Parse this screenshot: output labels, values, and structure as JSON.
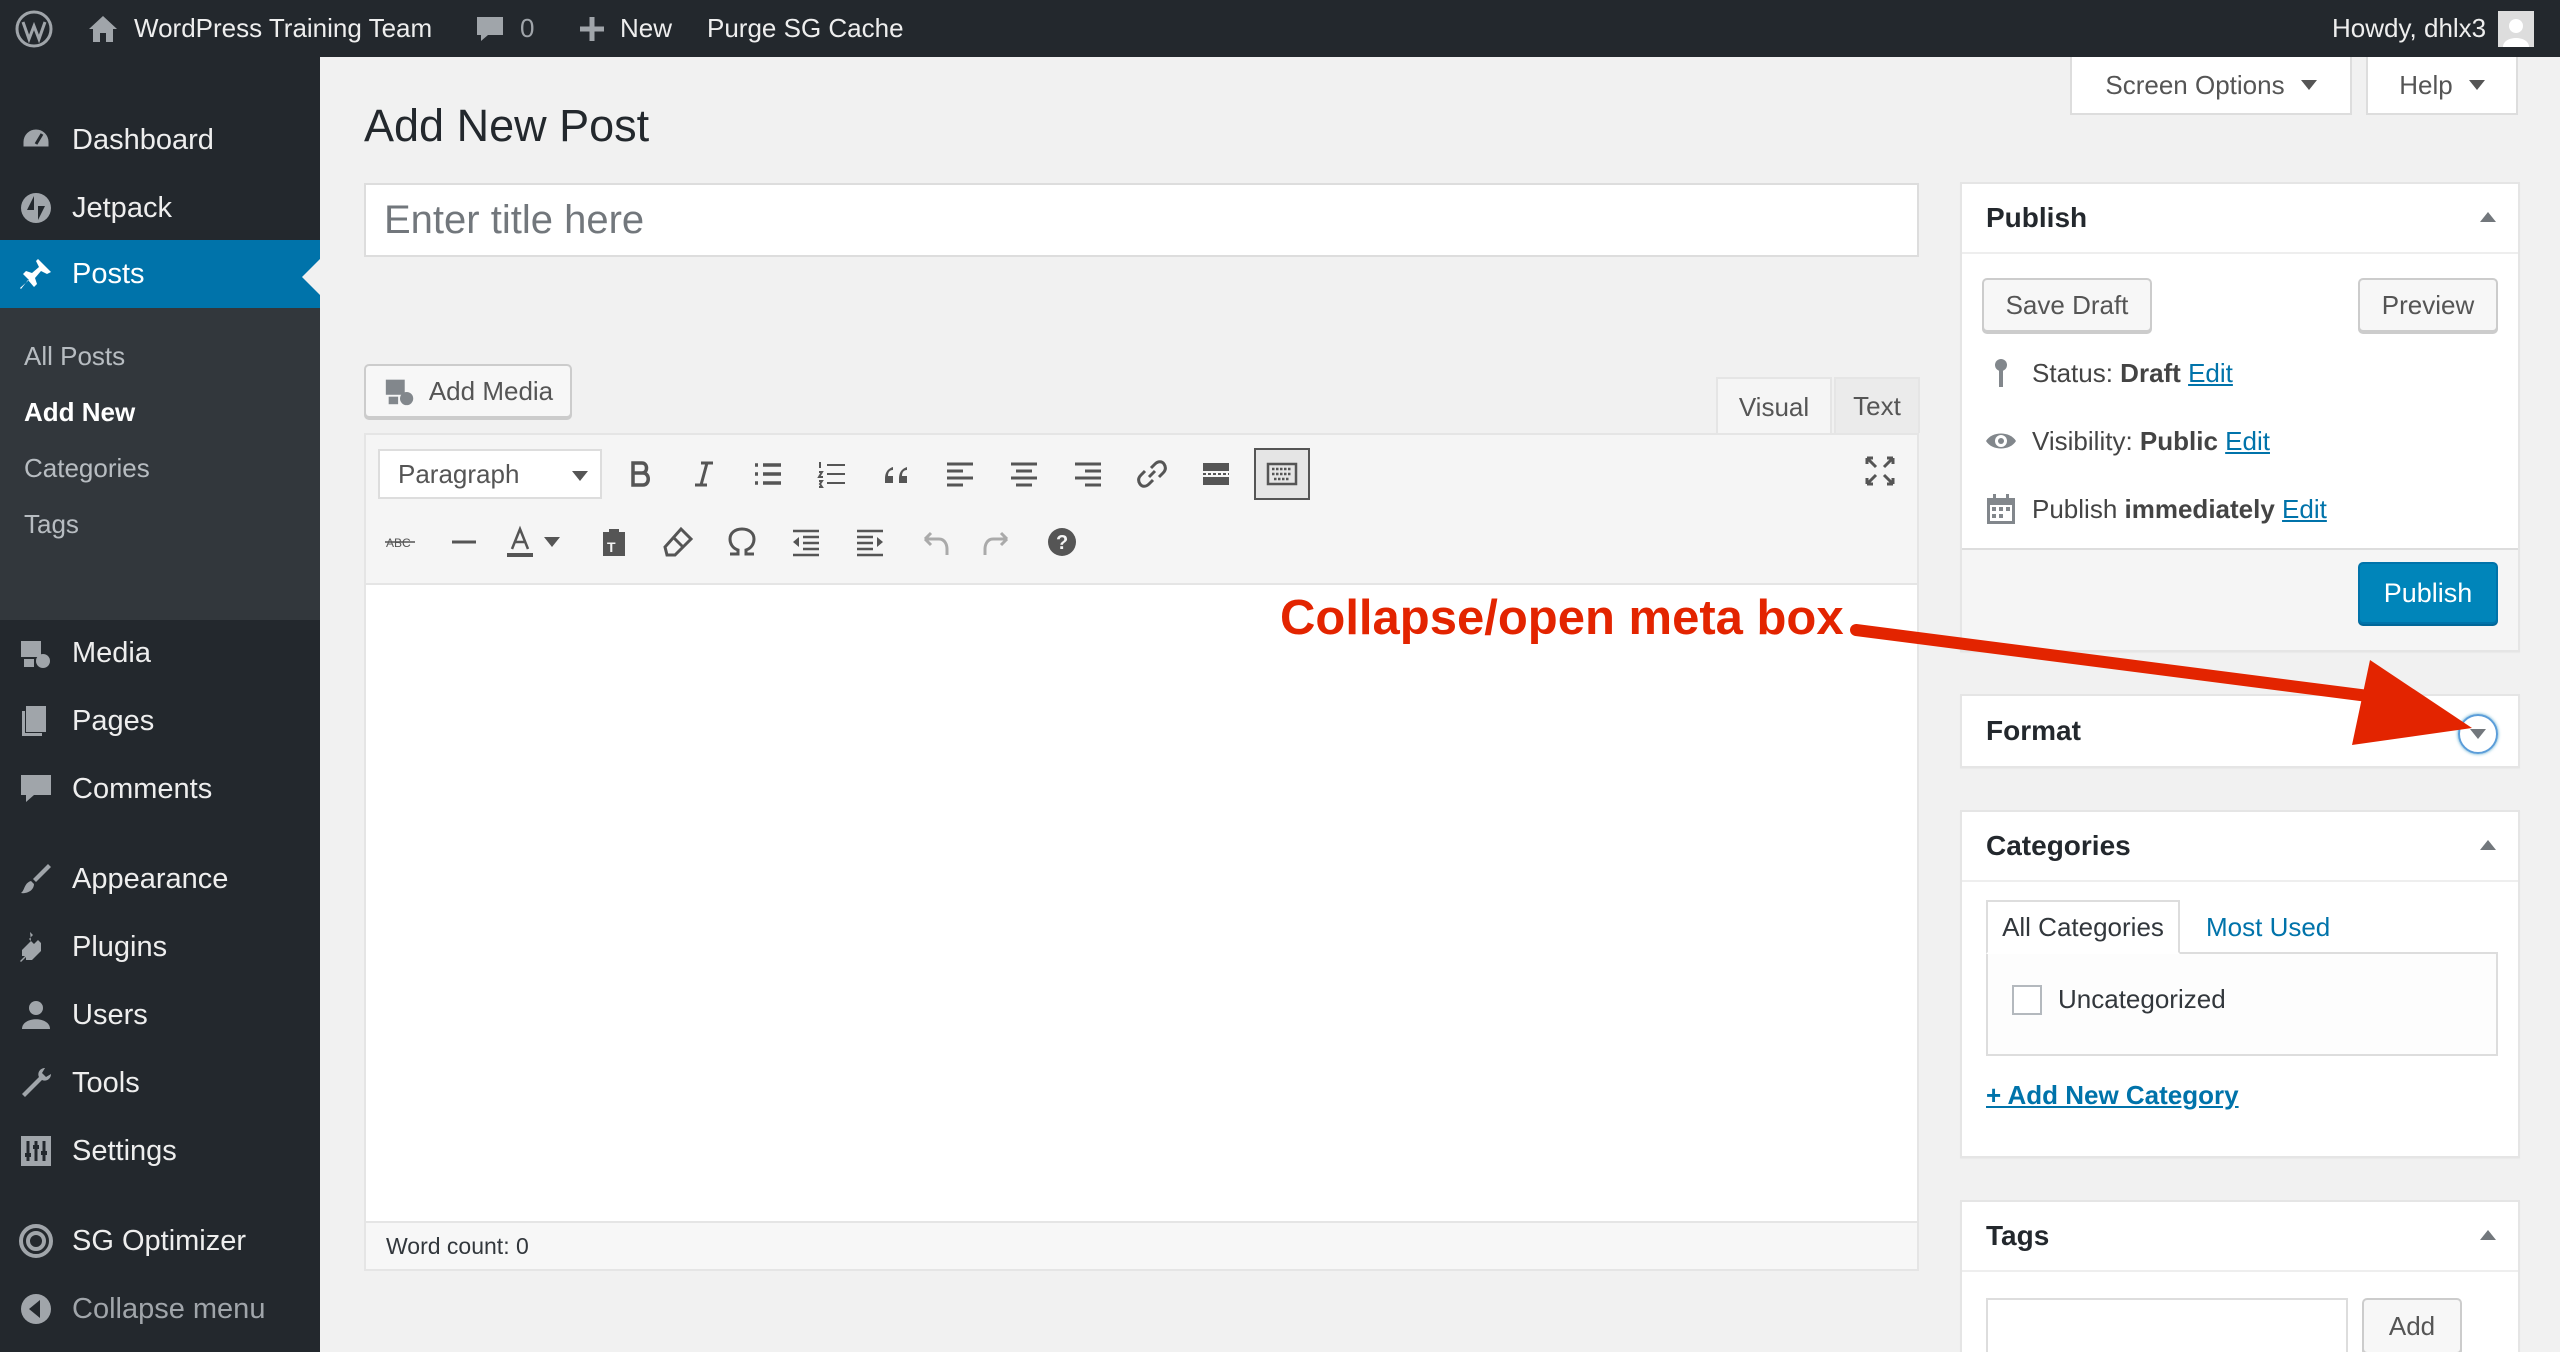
{
  "admin_bar": {
    "site_name": "WordPress Training Team",
    "comments_count": "0",
    "new_label": "New",
    "purge_label": "Purge SG Cache",
    "greeting": "Howdy, dhlx3"
  },
  "sidebar": {
    "items": [
      {
        "label": "Dashboard",
        "icon": "dashboard-icon"
      },
      {
        "label": "Jetpack",
        "icon": "jetpack-icon"
      },
      {
        "label": "Posts",
        "icon": "pin-icon"
      },
      {
        "label": "Media",
        "icon": "media-icon"
      },
      {
        "label": "Pages",
        "icon": "pages-icon"
      },
      {
        "label": "Comments",
        "icon": "comments-icon"
      },
      {
        "label": "Appearance",
        "icon": "appearance-icon"
      },
      {
        "label": "Plugins",
        "icon": "plugins-icon"
      },
      {
        "label": "Users",
        "icon": "users-icon"
      },
      {
        "label": "Tools",
        "icon": "tools-icon"
      },
      {
        "label": "Settings",
        "icon": "settings-icon"
      },
      {
        "label": "SG Optimizer",
        "icon": "sg-optimizer-icon"
      },
      {
        "label": "Collapse menu",
        "icon": "collapse-icon"
      }
    ],
    "submenu": [
      "All Posts",
      "Add New",
      "Categories",
      "Tags"
    ]
  },
  "header": {
    "title": "Add New Post",
    "screen_options": "Screen Options",
    "help": "Help"
  },
  "title_field": {
    "placeholder": "Enter title here",
    "value": ""
  },
  "editor": {
    "add_media": "Add Media",
    "tabs": [
      "Visual",
      "Text"
    ],
    "active_tab": "Visual",
    "format_select": "Paragraph",
    "word_count": "Word count: 0"
  },
  "publish_box": {
    "title": "Publish",
    "save_draft": "Save Draft",
    "preview": "Preview",
    "status_label": "Status:",
    "status_value": "Draft",
    "visibility_label": "Visibility:",
    "visibility_value": "Public",
    "publish_label": "Publish",
    "publish_value": "immediately",
    "edit": "Edit",
    "publish_button": "Publish"
  },
  "format_box": {
    "title": "Format"
  },
  "categories_box": {
    "title": "Categories",
    "tabs": [
      "All Categories",
      "Most Used"
    ],
    "items": [
      {
        "label": "Uncategorized",
        "checked": false
      }
    ],
    "add_new": "+ Add New Category"
  },
  "tags_box": {
    "title": "Tags",
    "add_button": "Add"
  },
  "annotation": {
    "text": "Collapse/open meta box",
    "color": "#e32400"
  },
  "colors": {
    "admin_bar": "#23282d",
    "accent": "#0073aa",
    "publish_button": "#0085ba",
    "background": "#f1f1f1"
  }
}
